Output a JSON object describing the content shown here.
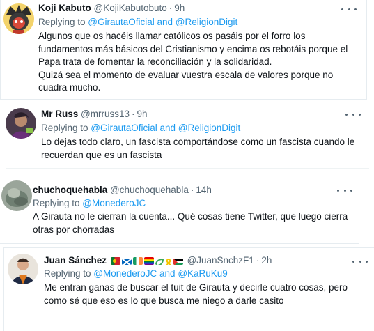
{
  "tweets": [
    {
      "name": "Koji Kabuto",
      "handle": "@KojiKabutobuto",
      "time": "9h",
      "replying_prefix": "Replying to ",
      "replying_to": "@GirautaOficial and @ReligionDigit",
      "text": "Algunos que os hacéis llamar católicos os pasáis por el forro los fundamentos más básicos del Cristianismo y encima os rebotáis porque el Papa trata de fomentar la reconciliación y la solidaridad.\nQuizá sea el momento de evaluar vuestra escala de valores porque no cuadra mucho."
    },
    {
      "name": "Mr Russ",
      "handle": "@mrruss13",
      "time": "9h",
      "replying_prefix": "Replying to ",
      "replying_to": "@GirautaOficial and @ReligionDigit",
      "text": "Lo dejas todo claro, un fascista comportándose como un fascista cuando le recuerdan que es un fascista"
    },
    {
      "name": "chuchoquehabla",
      "handle": "@chuchoquehabla",
      "time": "14h",
      "replying_prefix": "Replying to ",
      "replying_to": "@MonederoJC",
      "text": "A Girauta no le cierran la cuenta... Qué cosas tiene Twitter, que luego cierra otras por chorradas"
    },
    {
      "name": "Juan Sánchez",
      "handle": "@JuanSnchzF1",
      "time": "2h",
      "name_emojis": [
        "portugal-flag",
        "scotland-flag",
        "ireland-flag",
        "rainbow-flag",
        "eco-symbol",
        "yellow-ribbon",
        "palestine-flag"
      ],
      "replying_prefix": "Replying to ",
      "replying_to": "@MonederoJC and @KaRuKu9",
      "text": "Me entran ganas de buscar el tuit de Girauta y decirle cuatro cosas, pero como sé que eso es lo que busca me niego a darle casito"
    }
  ],
  "icons": {
    "more": "more-options-icon"
  },
  "colors": {
    "link": "#1d9bf0",
    "secondary_text": "#536471",
    "primary_text": "#0f1419",
    "border": "#eff3f4"
  }
}
